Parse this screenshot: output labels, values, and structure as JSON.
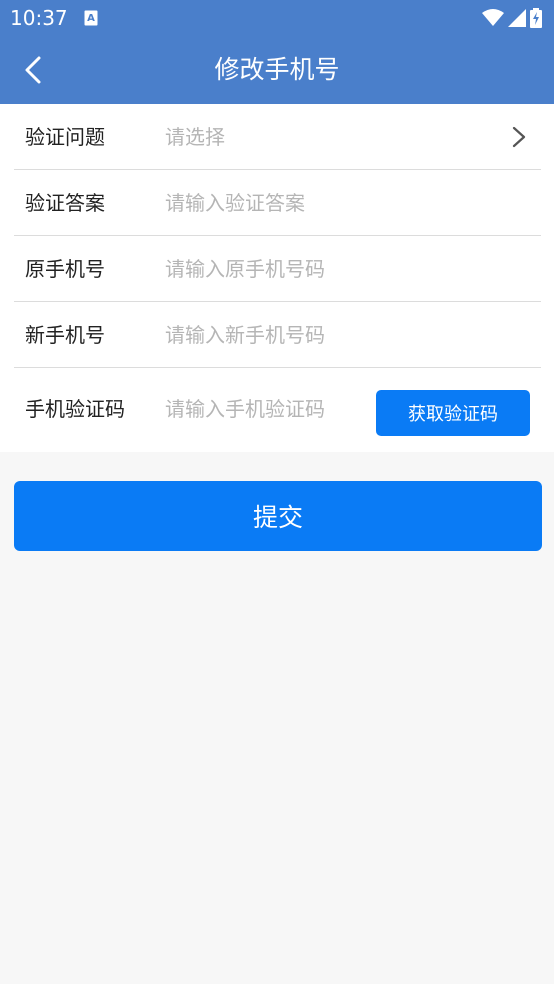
{
  "status_bar": {
    "time": "10:37",
    "icons": [
      "app-notification-icon",
      "wifi-icon",
      "cellular-signal-icon",
      "battery-charging-icon"
    ]
  },
  "header": {
    "title": "修改手机号",
    "back_icon": "chevron-left-icon"
  },
  "form": {
    "rows": [
      {
        "label": "验证问题",
        "placeholder": "请选择",
        "value": ""
      },
      {
        "label": "验证答案",
        "placeholder": "请输入验证答案",
        "value": ""
      },
      {
        "label": "原手机号",
        "placeholder": "请输入原手机号码",
        "value": ""
      },
      {
        "label": "新手机号",
        "placeholder": "请输入新手机号码",
        "value": ""
      },
      {
        "label": "手机验证码",
        "placeholder": "请输入手机验证码",
        "value": ""
      }
    ],
    "get_code_label": "获取验证码"
  },
  "submit_label": "提交",
  "colors": {
    "header_bg": "#4a7fcb",
    "accent": "#0a7bf5",
    "page_bg": "#f7f7f7",
    "placeholder": "#b5b5b5"
  }
}
